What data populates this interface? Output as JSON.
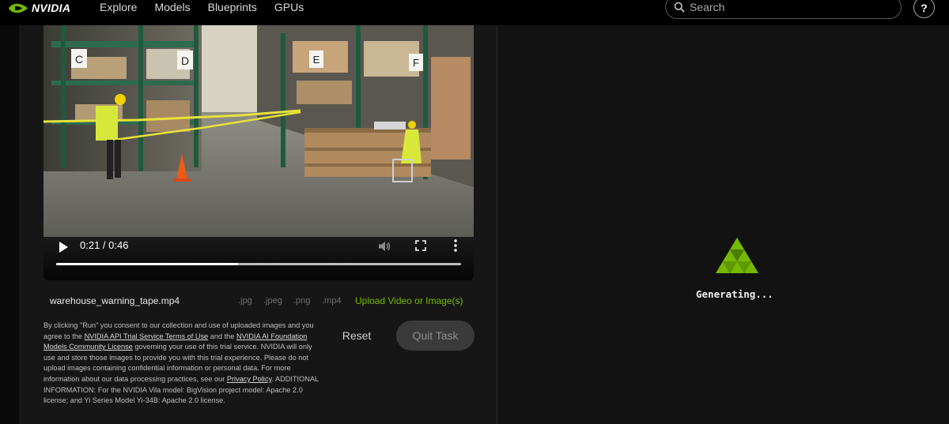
{
  "nav": {
    "brand": "NVIDIA",
    "links": [
      "Explore",
      "Models",
      "Blueprints",
      "GPUs"
    ],
    "search_placeholder": "Search",
    "help_label": "?"
  },
  "video": {
    "file": "warehouse_warning_tape.mp4",
    "time_display": "0:21 / 0:46",
    "progress": 0.45,
    "aisle_signs": [
      "C",
      "D",
      "E",
      "F"
    ]
  },
  "upload": {
    "formats": [
      ".jpg",
      ".jpeg",
      ".png",
      ".mp4"
    ],
    "label": "Upload Video or Image(s)"
  },
  "consent": {
    "p1": "By clicking \"Run\" you consent to our collection and use of uploaded images and you agree to the ",
    "link1": "NVIDIA API Trial Service Terms of Use",
    "p2": " and the ",
    "link2": "NVIDIA AI Foundation Models Community License",
    "p3": " governing your use of this trial service. NVIDIA will only use and store those images to provide you with this trial experience. Please do not upload images containing confidential information or personal data. For more information about our data processing practices, see our ",
    "link3": "Privacy Policy",
    "p4": ". ADDITIONAL INFORMATION: For the NVIDIA Vila model: BigVision project model: Apache 2.0 license; and Yi Series Model Yi-34B: Apache 2.0 license."
  },
  "buttons": {
    "reset": "Reset",
    "quit": "Quit Task"
  },
  "status": {
    "text": "Generating..."
  },
  "colors": {
    "accent": "#76b900",
    "background": "#111111"
  }
}
